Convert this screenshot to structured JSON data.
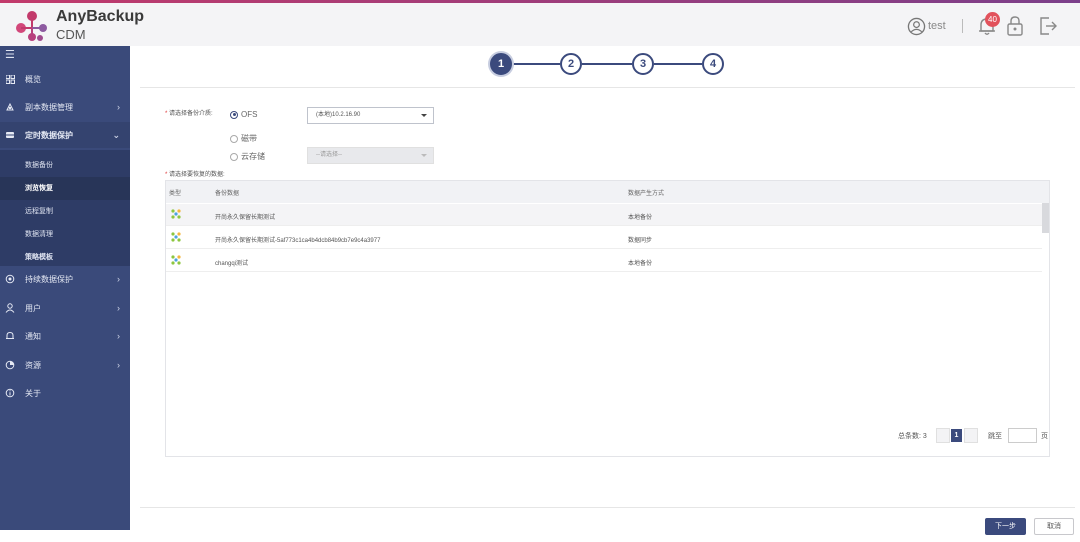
{
  "app": {
    "brand": "AnyBackup",
    "product": "CDM"
  },
  "header": {
    "user": "test",
    "notifications": "40"
  },
  "sidebar": {
    "items": [
      {
        "label": "概览",
        "icon": "grid-icon"
      },
      {
        "label": "副本数据管理",
        "icon": "copy-data-icon"
      },
      {
        "label": "定时数据保护",
        "icon": "backup-icon"
      },
      {
        "label": "持续数据保护",
        "icon": "continuous-icon"
      },
      {
        "label": "用户",
        "icon": "user-icon"
      },
      {
        "label": "通知",
        "icon": "bell-icon"
      },
      {
        "label": "资源",
        "icon": "pie-icon"
      },
      {
        "label": "关于",
        "icon": "info-icon"
      }
    ],
    "sub_items": [
      "数据备份",
      "浏览恢复",
      "远程复制",
      "数据清理",
      "策略模板"
    ],
    "selected_sub": "浏览恢复"
  },
  "wizard": {
    "steps": [
      "1",
      "2",
      "3",
      "4"
    ],
    "current": 1
  },
  "form": {
    "medium_label": "请选择备份介质:",
    "data_label": "请选择要恢复的数据:",
    "required_mark": "*",
    "options": [
      "OFS",
      "磁带",
      "云存储"
    ],
    "selected_option": "OFS",
    "ofs_select_value": "(本地)10.2.16.90",
    "cloud_select_placeholder": "--请选择--"
  },
  "table": {
    "columns": [
      "类型",
      "备份数据",
      "数据产生方式"
    ],
    "rows": [
      {
        "name": "开尚永久保留长期测试",
        "mode": "本地备份"
      },
      {
        "name": "开尚永久保留长期测试-5af773c1ca4b4dcb84b9cb7e9c4a3977",
        "mode": "数据同步"
      },
      {
        "name": "changqi测试",
        "mode": "本地备份"
      }
    ]
  },
  "pager": {
    "total_label": "总条数: 3",
    "current_page": "1",
    "goto_label": "跳至",
    "page_unit": "页"
  },
  "footer": {
    "next_label": "下一步",
    "cancel_label": "取消"
  },
  "colors": {
    "primary": "#3b4a7d",
    "sidebar": "#3a4a7a",
    "badge": "#e2525c"
  }
}
